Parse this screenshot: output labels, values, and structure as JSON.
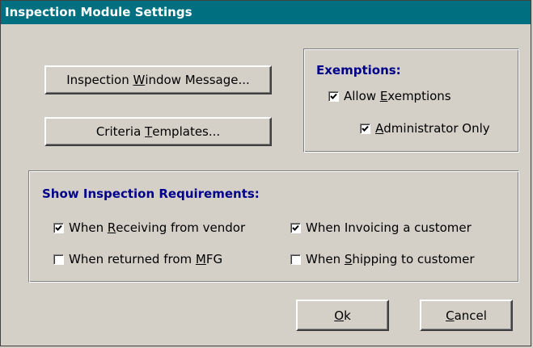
{
  "window": {
    "title": "Inspection Module Settings"
  },
  "buttons": {
    "inspection_window_message": {
      "pre": "Inspection ",
      "key": "W",
      "post": "indow Message..."
    },
    "criteria_templates": {
      "pre": "Criteria ",
      "key": "T",
      "post": "emplates..."
    },
    "ok": {
      "pre": "",
      "key": "O",
      "post": "k"
    },
    "cancel": {
      "pre": "",
      "key": "C",
      "post": "ancel"
    }
  },
  "exemptions": {
    "title": "Exemptions:",
    "allow": {
      "pre": "Allow ",
      "key": "E",
      "post": "xemptions",
      "checked": true
    },
    "admin_only": {
      "pre": "",
      "key": "A",
      "post": "dministrator Only",
      "checked": true
    }
  },
  "requirements": {
    "title": "Show Inspection Requirements:",
    "receiving": {
      "pre": "When ",
      "key": "R",
      "post": "eceiving from vendor",
      "checked": true
    },
    "invoicing": {
      "pre": "When Invoicing a customer",
      "key": "",
      "post": "",
      "checked": true
    },
    "returned": {
      "pre": "When returned from ",
      "key": "M",
      "post": "FG",
      "checked": false
    },
    "shipping": {
      "pre": "When ",
      "key": "S",
      "post": "hipping to customer",
      "checked": false
    }
  },
  "colors": {
    "titlebar": "#006f80",
    "group_title": "#00008b",
    "face": "#d4d0c8"
  },
  "icons": {
    "check": "checkmark-icon"
  }
}
